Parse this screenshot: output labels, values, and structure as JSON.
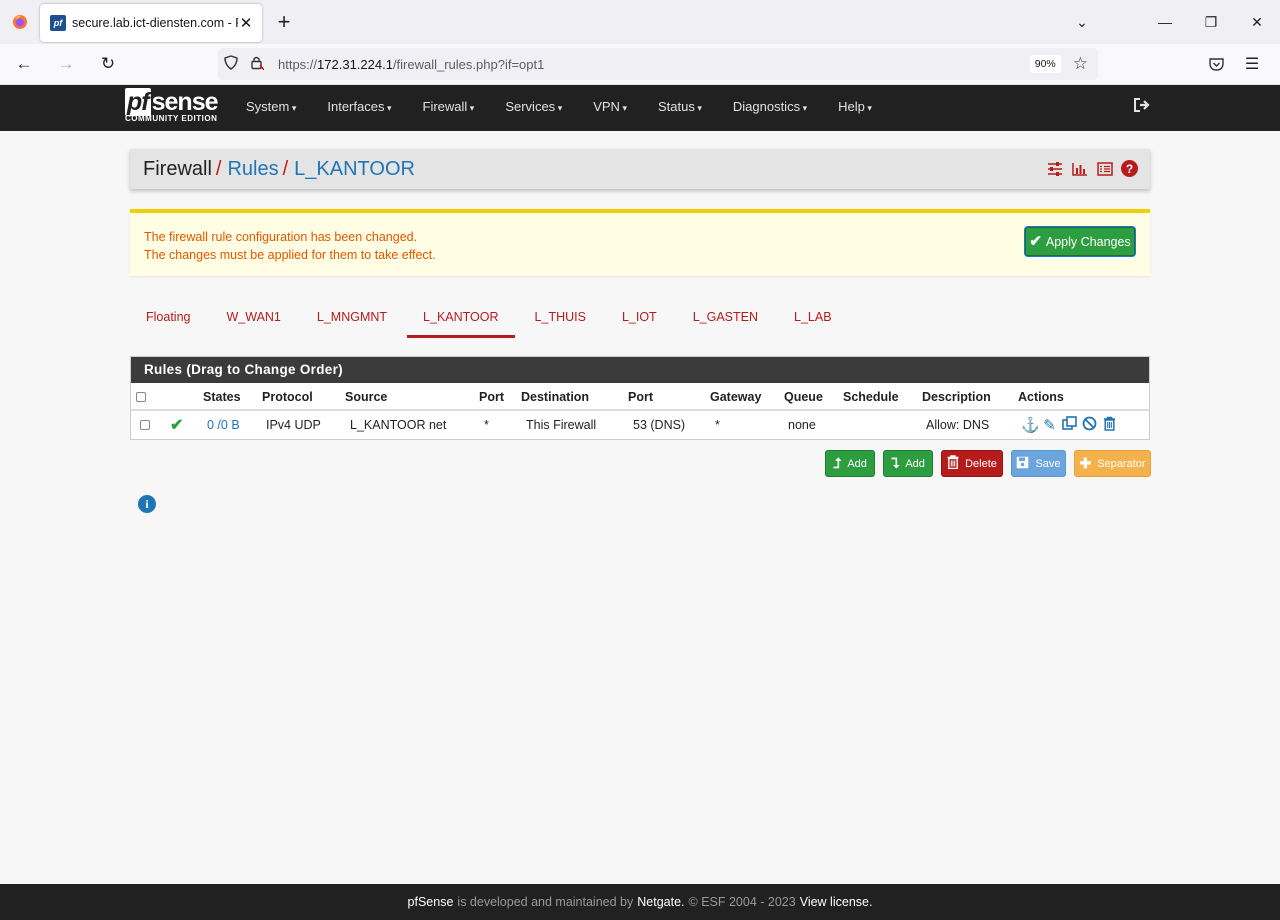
{
  "browser": {
    "tab_title": "secure.lab.ict-diensten.com - Fi",
    "favicon_text": "pf",
    "url_prefix": "https://",
    "url_host": "172.31.224.1",
    "url_path": "/firewall_rules.php?if=opt1",
    "zoom": "90%"
  },
  "pfsense": {
    "brand_pf": "pf",
    "brand_sense": "sense",
    "edition": "COMMUNITY EDITION",
    "menu": [
      "System",
      "Interfaces",
      "Firewall",
      "Services",
      "VPN",
      "Status",
      "Diagnostics",
      "Help"
    ]
  },
  "breadcrumb": {
    "items": [
      "Firewall",
      "Rules",
      "L_KANTOOR"
    ],
    "separator": "/"
  },
  "alert": {
    "line1": "The firewall rule configuration has been changed.",
    "line2": "The changes must be applied for them to take effect.",
    "apply_label": "Apply Changes"
  },
  "interface_tabs": [
    "Floating",
    "W_WAN1",
    "L_MNGMNT",
    "L_KANTOOR",
    "L_THUIS",
    "L_IOT",
    "L_GASTEN",
    "L_LAB"
  ],
  "active_tab": "L_KANTOOR",
  "rules_table": {
    "heading": "Rules (Drag to Change Order)",
    "columns": [
      "States",
      "Protocol",
      "Source",
      "Port",
      "Destination",
      "Port",
      "Gateway",
      "Queue",
      "Schedule",
      "Description",
      "Actions"
    ],
    "rows": [
      {
        "states": "0 /0 B",
        "protocol": "IPv4 UDP",
        "source": "L_KANTOOR net",
        "source_port": "*",
        "destination": "This Firewall",
        "dest_port": "53 (DNS)",
        "gateway": "*",
        "queue": "none",
        "schedule": "",
        "description": "Allow: DNS"
      }
    ]
  },
  "buttons": {
    "add_top": "Add",
    "add_bottom": "Add",
    "delete": "Delete",
    "save": "Save",
    "separator": "Separator"
  },
  "footer": {
    "product": "pfSense",
    "text1": "is developed and maintained by",
    "company": "Netgate.",
    "text2": "© ESF 2004 - 2023",
    "license": "View license."
  },
  "colors": {
    "pfsense_red": "#b71c1c",
    "link_blue": "#1f75b6",
    "success_green": "#2d9e3f",
    "warning_orange": "#e25800",
    "navbar_dark": "#212121"
  }
}
